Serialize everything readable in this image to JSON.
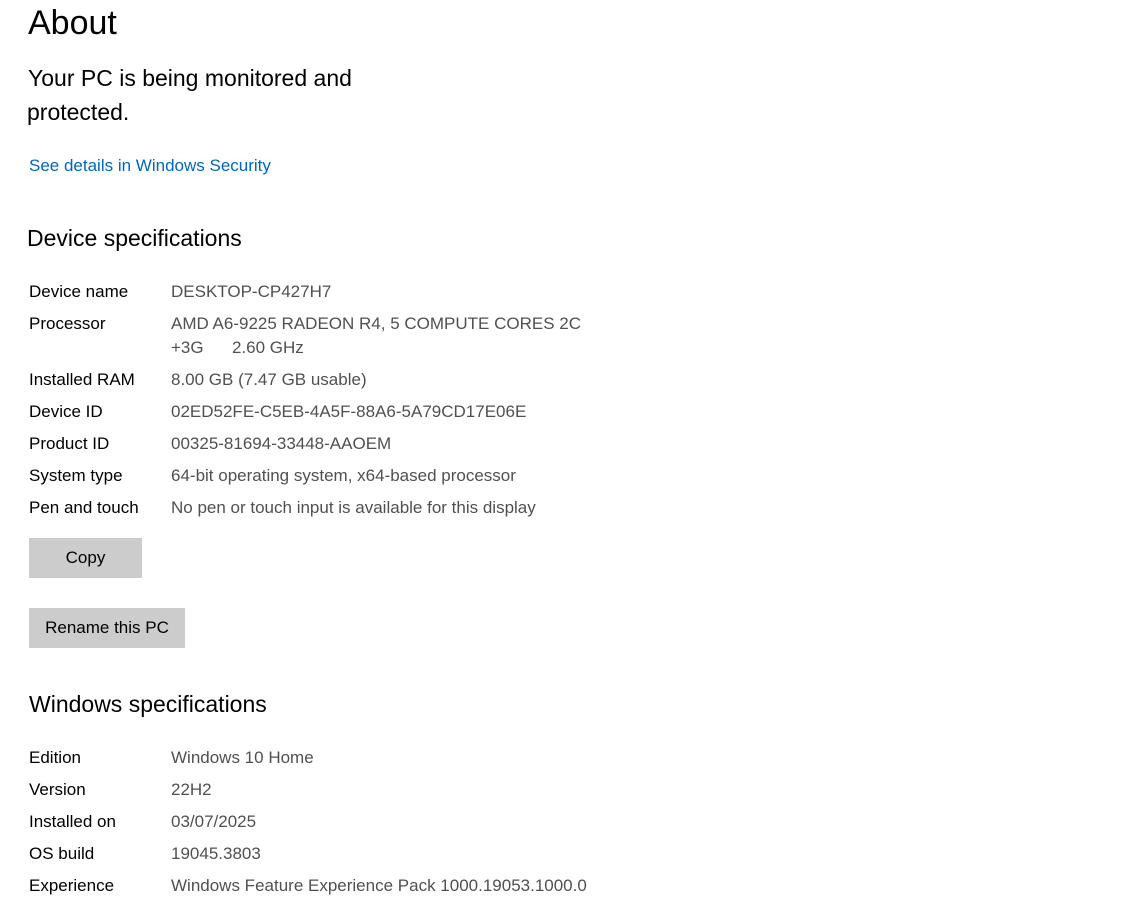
{
  "page": {
    "title": "About",
    "protection_line1": "Your PC is being monitored and",
    "protection_line2": "protected.",
    "security_link": "See details in Windows Security"
  },
  "device": {
    "heading": "Device specifications",
    "rows": [
      {
        "label": "Device name",
        "value": "DESKTOP-CP427H7"
      },
      {
        "label": "Processor",
        "value": "AMD A6-9225 RADEON R4, 5 COMPUTE CORES 2C",
        "value2": "+3G      2.60 GHz"
      },
      {
        "label": "Installed RAM",
        "value": "8.00 GB (7.47 GB usable)"
      },
      {
        "label": "Device ID",
        "value": "02ED52FE-C5EB-4A5F-88A6-5A79CD17E06E"
      },
      {
        "label": "Product ID",
        "value": "00325-81694-33448-AAOEM"
      },
      {
        "label": "System type",
        "value": "64-bit operating system, x64-based processor"
      },
      {
        "label": "Pen and touch",
        "value": "No pen or touch input is available for this display"
      }
    ],
    "copy_label": "Copy",
    "rename_label": "Rename this PC"
  },
  "windows": {
    "heading": "Windows specifications",
    "rows": [
      {
        "label": "Edition",
        "value": "Windows 10 Home"
      },
      {
        "label": "Version",
        "value": "22H2"
      },
      {
        "label": "Installed on",
        "value": "03/07/2025"
      },
      {
        "label": "OS build",
        "value": "19045.3803"
      },
      {
        "label": "Experience",
        "value": "Windows Feature Experience Pack 1000.19053.1000.0"
      }
    ]
  },
  "colors": {
    "link": "#0067c0",
    "value_text": "#505050",
    "button_bg": "#cccccc"
  }
}
